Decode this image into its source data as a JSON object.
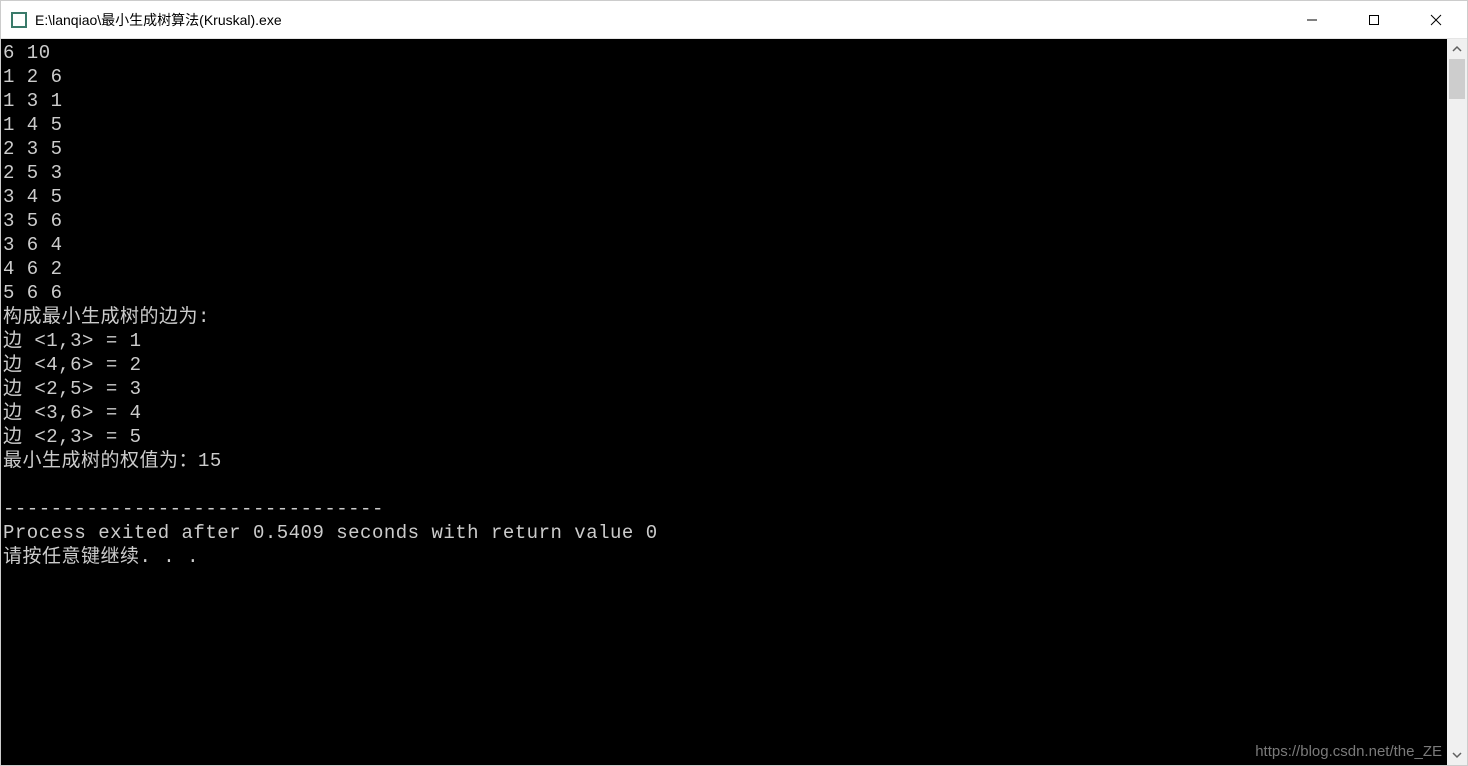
{
  "window": {
    "title": "E:\\lanqiao\\最小生成树算法(Kruskal).exe"
  },
  "console": {
    "lines": [
      "6 10",
      "1 2 6",
      "1 3 1",
      "1 4 5",
      "2 3 5",
      "2 5 3",
      "3 4 5",
      "3 5 6",
      "3 6 4",
      "4 6 2",
      "5 6 6",
      "构成最小生成树的边为:",
      "边 <1,3> = 1",
      "边 <4,6> = 2",
      "边 <2,5> = 3",
      "边 <3,6> = 4",
      "边 <2,3> = 5",
      "最小生成树的权值为：15",
      "",
      "--------------------------------",
      "Process exited after 0.5409 seconds with return value 0",
      "请按任意键继续. . ."
    ]
  },
  "watermark": "https://blog.csdn.net/the_ZE"
}
